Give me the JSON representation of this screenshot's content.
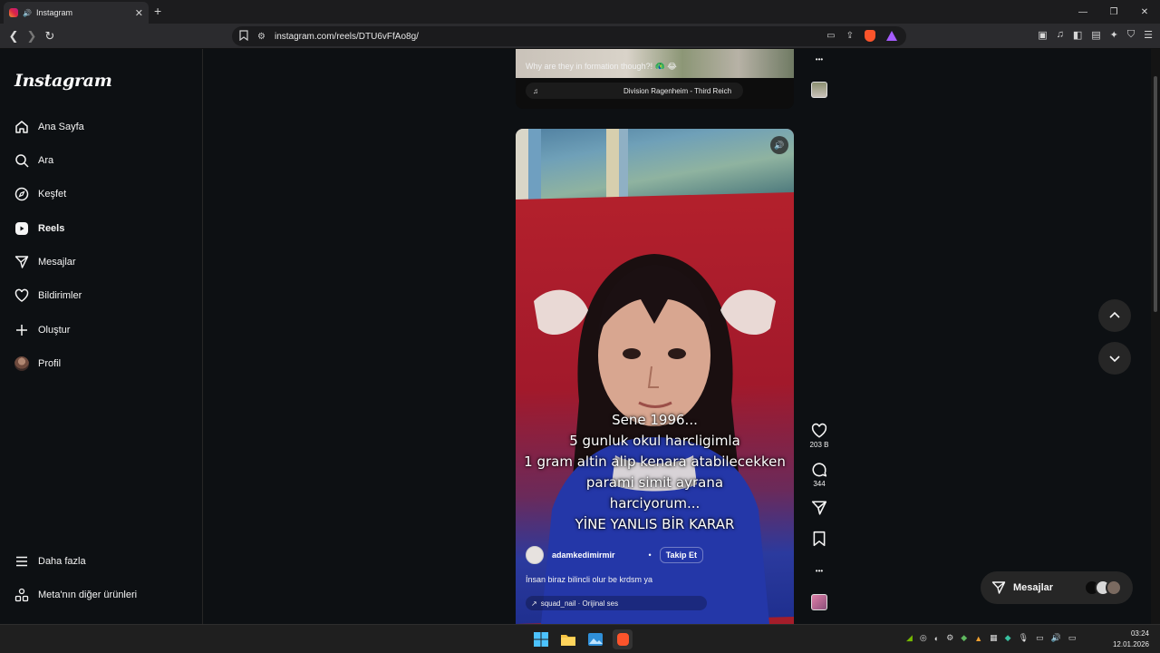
{
  "browser": {
    "tab_title": "Instagram",
    "url": "instagram.com/reels/DTU6vFfAo8g/"
  },
  "sidebar": {
    "logo": "Instagram",
    "items": [
      {
        "label": "Ana Sayfa",
        "icon": "home-icon"
      },
      {
        "label": "Ara",
        "icon": "search-icon"
      },
      {
        "label": "Keşfet",
        "icon": "compass-icon"
      },
      {
        "label": "Reels",
        "icon": "reels-icon"
      },
      {
        "label": "Mesajlar",
        "icon": "send-icon"
      },
      {
        "label": "Bildirimler",
        "icon": "heart-icon"
      },
      {
        "label": "Oluştur",
        "icon": "plus-icon"
      },
      {
        "label": "Profil",
        "icon": "avatar"
      }
    ],
    "bottom": [
      {
        "label": "Daha fazla",
        "icon": "menu-icon"
      },
      {
        "label": "Meta'nın diğer ürünleri",
        "icon": "apps-icon"
      }
    ]
  },
  "previous_reel": {
    "caption": "Why are they in formation though?! 🦚 😂",
    "song": "Division Ragenheim - Third Reich"
  },
  "reel": {
    "overlay_lines": [
      "Sene 1996...",
      "5 gunluk okul harcligimla",
      "1 gram altin alip kenara atabilecekken",
      "parami simit ayrana",
      "harciyorum...",
      "YİNE YANLIS BİR KARAR"
    ],
    "author": "adamkedimirmir",
    "follow_label": "Takip Et",
    "caption": "İnsan biraz bilincli olur be krdsm ya",
    "audio": "squad_nail · Orijinal ses"
  },
  "actions": {
    "likes": "203 B",
    "comments": "344"
  },
  "messages_pill": {
    "label": "Mesajlar"
  },
  "clock": {
    "time": "03:24",
    "date": "12.01.2026"
  },
  "colors": {
    "background": "#0d1013",
    "reel_red": "#a41d2a",
    "reel_blue": "#1f2f8f"
  }
}
